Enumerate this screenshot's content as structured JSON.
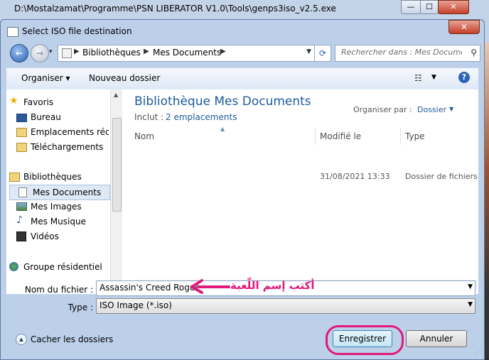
{
  "console": {
    "title": "D:\\Mostalzamat\\Programme\\PSN LIBERATOR V1.0\\Tools\\genps3iso_v2.5.exe",
    "minimize": "—",
    "maximize": "☐",
    "close": "✕"
  },
  "dialog": {
    "title": "Select ISO file destination",
    "close": "✕"
  },
  "address": {
    "crumbs": [
      "Bibliothèques",
      "Mes Documents"
    ],
    "search_placeholder": "Rechercher dans : Mes Documents"
  },
  "toolbar": {
    "organize": "Organiser ▾",
    "new_folder": "Nouveau dossier",
    "help": "?"
  },
  "sidebar": {
    "items": [
      {
        "label": "Favoris",
        "icon": "star-icon"
      },
      {
        "label": "Bureau",
        "icon": "desktop-icon"
      },
      {
        "label": "Emplacements récents",
        "icon": "recent-places-icon"
      },
      {
        "label": "Téléchargements",
        "icon": "downloads-icon"
      },
      {
        "label": "Bibliothèques",
        "icon": "libraries-icon"
      },
      {
        "label": "Mes Documents",
        "icon": "documents-icon"
      },
      {
        "label": "Mes Images",
        "icon": "pictures-icon"
      },
      {
        "label": "Mes Musique",
        "icon": "music-icon"
      },
      {
        "label": "Vidéos",
        "icon": "videos-icon"
      },
      {
        "label": "Groupe résidentiel",
        "icon": "homegroup-icon"
      }
    ]
  },
  "library": {
    "title": "Bibliothèque Mes Documents",
    "includes_label": "Inclut :",
    "includes_link": "2 emplacements",
    "arrange_label": "Organiser par :",
    "arrange_value": "Dossier"
  },
  "columns": [
    "Nom",
    "Modifié le",
    "Type"
  ],
  "rows": [
    {
      "name": "",
      "modified": "31/08/2021 13:33",
      "type": "Dossier de fichiers"
    }
  ],
  "form": {
    "filename_label": "Nom du fichier :",
    "filename_value": "Assassin's Creed Rogue",
    "type_label": "Type :",
    "type_value": "ISO Image (*.iso)"
  },
  "annotation": {
    "text": "أكتب إسم اللّعبة",
    "color": "#e0197b"
  },
  "footer": {
    "hide_folders": "Cacher les dossiers",
    "save": "Enregistrer",
    "cancel": "Annuler"
  }
}
